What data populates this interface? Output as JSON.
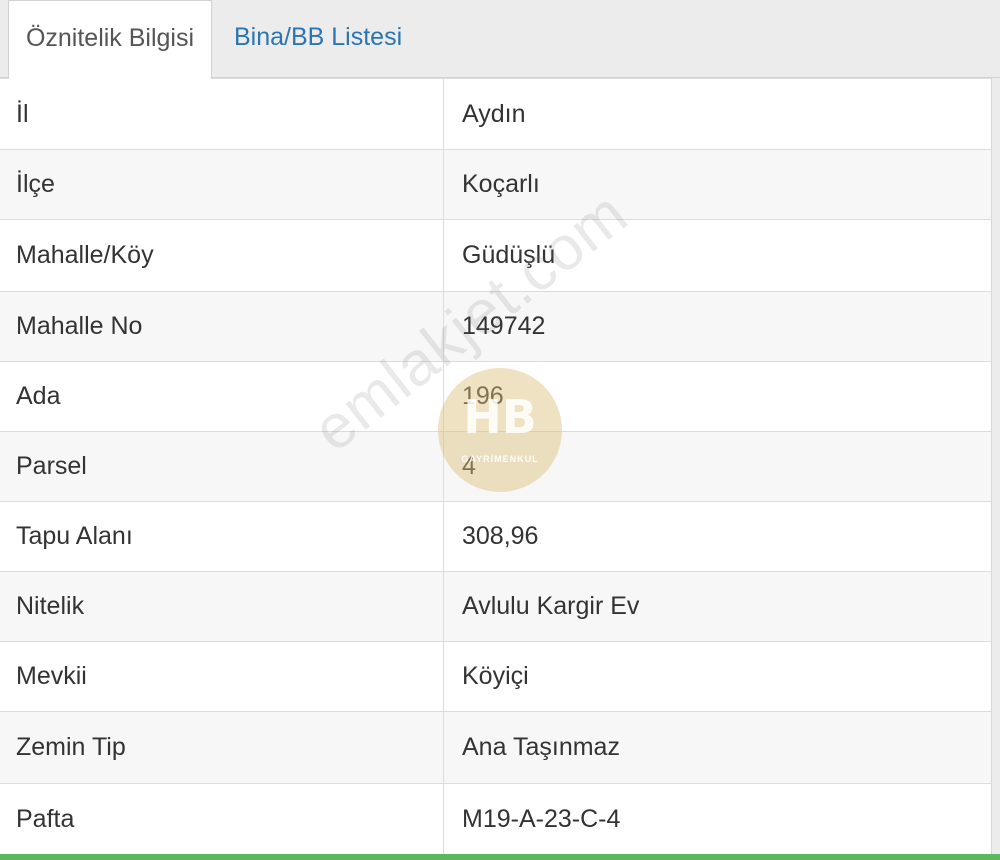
{
  "tabs": [
    {
      "label": "Öznitelik Bilgisi",
      "active": true
    },
    {
      "label": "Bina/BB Listesi",
      "active": false
    }
  ],
  "rows": [
    {
      "label": "İl",
      "value": "Aydın"
    },
    {
      "label": "İlçe",
      "value": "Koçarlı"
    },
    {
      "label": "Mahalle/Köy",
      "value": "Güdüşlü"
    },
    {
      "label": "Mahalle No",
      "value": "149742"
    },
    {
      "label": "Ada",
      "value": "196"
    },
    {
      "label": "Parsel",
      "value": "4"
    },
    {
      "label": "Tapu Alanı",
      "value": "308,96"
    },
    {
      "label": "Nitelik",
      "value": "Avlulu Kargir Ev"
    },
    {
      "label": "Mevkii",
      "value": "Köyiçi"
    },
    {
      "label": "Zemin Tip",
      "value": "Ana Taşınmaz"
    },
    {
      "label": "Pafta",
      "value": "M19-A-23-C-4"
    }
  ],
  "watermark": {
    "text": "emlakjet.com",
    "logo_mark": "HB",
    "logo_sub": "GAYRİMENKUL"
  },
  "colors": {
    "tab_link": "#2a75b3",
    "accent_bar": "#5cb85c"
  }
}
